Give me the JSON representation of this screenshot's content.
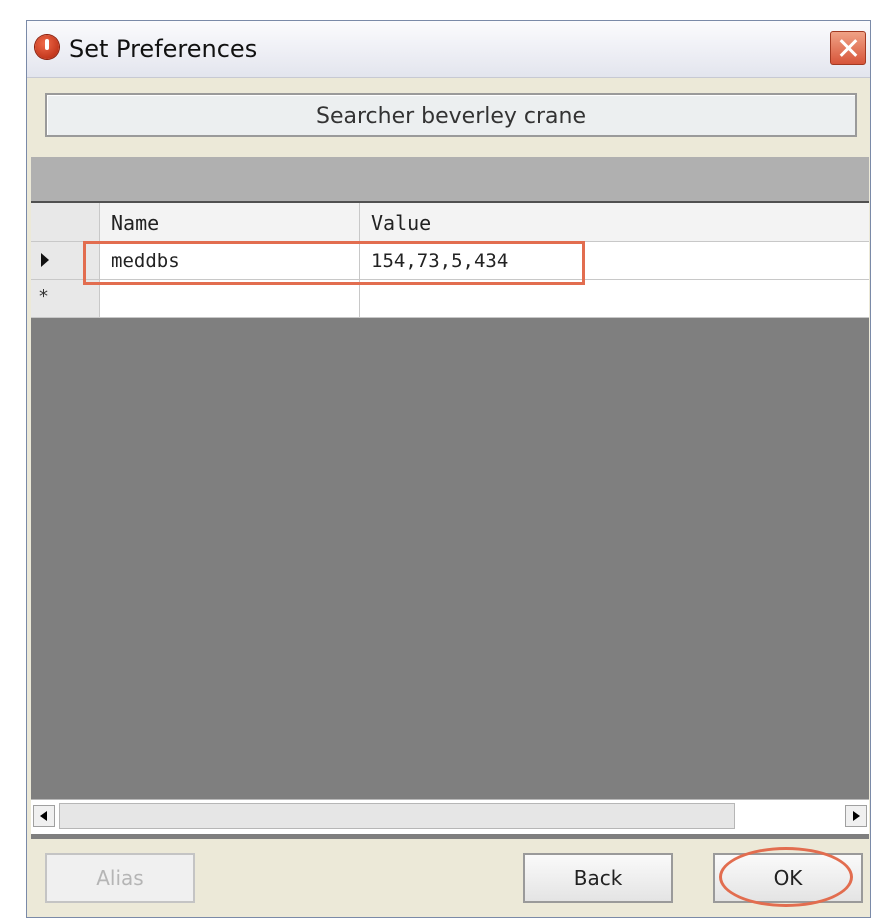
{
  "window": {
    "title": "Set Preferences",
    "icon": "app-logo-icon",
    "close_icon": "close-icon"
  },
  "header": {
    "text": "Searcher beverley crane"
  },
  "grid": {
    "columns": [
      "Name",
      "Value"
    ],
    "rows": [
      {
        "name": "meddbs",
        "value": "154,73,5,434",
        "current": true
      }
    ],
    "new_row_marker": "*"
  },
  "buttons": {
    "disabled_label": "Alias",
    "back": "Back",
    "ok": "OK"
  },
  "colors": {
    "highlight": "#e26d4f",
    "grid_background": "#7f7f7f"
  }
}
